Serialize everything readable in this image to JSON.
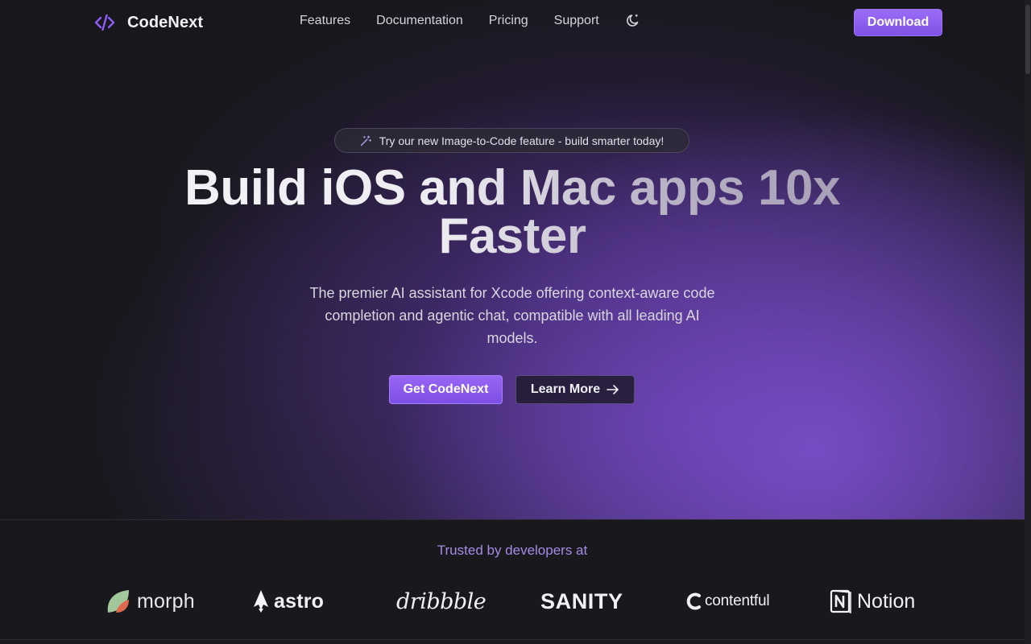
{
  "nav": {
    "brand": "CodeNext",
    "links": [
      "Features",
      "Documentation",
      "Pricing",
      "Support"
    ],
    "theme_toggle_icon": "moon-icon",
    "download_label": "Download"
  },
  "hero": {
    "announcement": "Try our new Image-to-Code feature - build smarter today!",
    "headline_line1": "Build iOS and Mac apps 10x",
    "headline_line2": "Faster",
    "subtitle": "The premier AI assistant for Xcode offering context-aware code completion and agentic chat, compatible with all leading AI models.",
    "primary_cta": "Get CodeNext",
    "secondary_cta": "Learn More"
  },
  "trusted": {
    "heading": "Trusted by developers at",
    "logos": [
      "morph",
      "astro",
      "dribbble",
      "SANITY",
      "contentful",
      "Notion"
    ]
  },
  "colors": {
    "accent": "#8b5cf6",
    "background": "#19181d",
    "trusted_text": "#a48be6"
  }
}
